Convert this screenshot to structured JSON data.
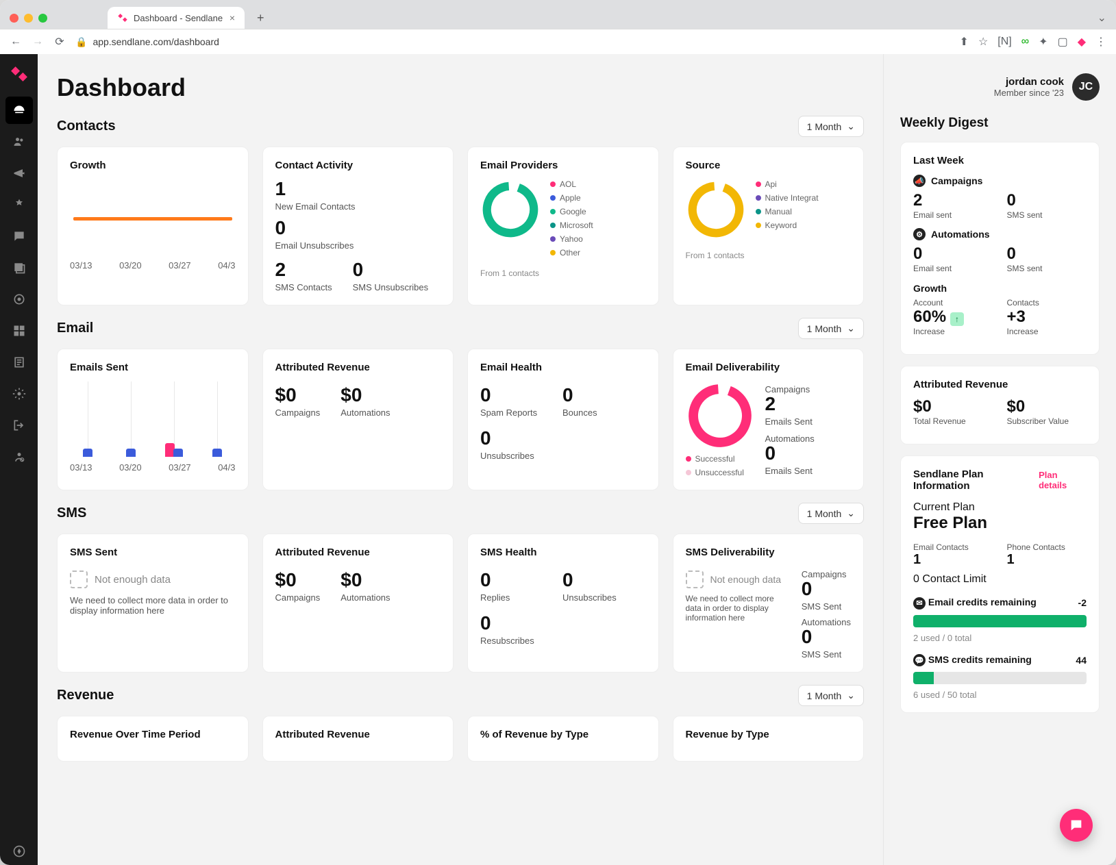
{
  "browser": {
    "tab_title": "Dashboard - Sendlane",
    "url": "app.sendlane.com/dashboard"
  },
  "page_title": "Dashboard",
  "user": {
    "name": "jordan cook",
    "member_since": "Member since '23",
    "initials": "JC"
  },
  "range_label": "1 Month",
  "contacts": {
    "title": "Contacts",
    "growth": {
      "title": "Growth",
      "x": [
        "03/13",
        "03/20",
        "03/27",
        "04/3"
      ]
    },
    "activity": {
      "title": "Contact Activity",
      "new_email_value": "1",
      "new_email_label": "New Email Contacts",
      "unsub_value": "0",
      "unsub_label": "Email Unsubscribes",
      "sms_contacts_value": "2",
      "sms_contacts_label": "SMS Contacts",
      "sms_unsub_value": "0",
      "sms_unsub_label": "SMS Unsubscribes"
    },
    "providers": {
      "title": "Email Providers",
      "legend": [
        "AOL",
        "Apple",
        "Google",
        "Microsoft",
        "Yahoo",
        "Other"
      ],
      "note": "From 1 contacts"
    },
    "source": {
      "title": "Source",
      "legend": [
        "Api",
        "Native Integrat",
        "Manual",
        "Keyword"
      ],
      "note": "From 1 contacts"
    }
  },
  "email": {
    "title": "Email",
    "sent": {
      "title": "Emails Sent",
      "x": [
        "03/13",
        "03/20",
        "03/27",
        "04/3"
      ]
    },
    "attributed": {
      "title": "Attributed Revenue",
      "campaigns_value": "$0",
      "campaigns_label": "Campaigns",
      "automations_value": "$0",
      "automations_label": "Automations"
    },
    "health": {
      "title": "Email Health",
      "spam_value": "0",
      "spam_label": "Spam Reports",
      "bounces_value": "0",
      "bounces_label": "Bounces",
      "unsub_value": "0",
      "unsub_label": "Unsubscribes"
    },
    "deliverability": {
      "title": "Email Deliverability",
      "legend": [
        "Successful",
        "Unsuccessful"
      ],
      "campaigns_label": "Campaigns",
      "campaigns_value": "2",
      "campaigns_sub": "Emails Sent",
      "automations_label": "Automations",
      "automations_value": "0",
      "automations_sub": "Emails Sent"
    }
  },
  "sms": {
    "title": "SMS",
    "sent": {
      "title": "SMS Sent",
      "ne_title": "Not enough data",
      "ne_body": "We need to collect more data in order to display information here"
    },
    "attributed": {
      "title": "Attributed Revenue",
      "campaigns_value": "$0",
      "campaigns_label": "Campaigns",
      "automations_value": "$0",
      "automations_label": "Automations"
    },
    "health": {
      "title": "SMS Health",
      "replies_value": "0",
      "replies_label": "Replies",
      "unsub_value": "0",
      "unsub_label": "Unsubscribes",
      "resub_value": "0",
      "resub_label": "Resubscribes"
    },
    "deliverability": {
      "title": "SMS Deliverability",
      "ne_title": "Not enough data",
      "ne_body": "We need to collect more data in order to display information here",
      "campaigns_label": "Campaigns",
      "campaigns_value": "0",
      "campaigns_sub": "SMS Sent",
      "automations_label": "Automations",
      "automations_value": "0",
      "automations_sub": "SMS Sent"
    }
  },
  "revenue": {
    "title": "Revenue",
    "cards": [
      "Revenue Over Time Period",
      "Attributed Revenue",
      "% of Revenue by Type",
      "Revenue by Type"
    ]
  },
  "digest": {
    "title": "Weekly Digest",
    "last_week": "Last Week",
    "campaigns_label": "Campaigns",
    "campaigns_email_value": "2",
    "campaigns_email_label": "Email sent",
    "campaigns_sms_value": "0",
    "campaigns_sms_label": "SMS sent",
    "automations_label": "Automations",
    "auto_email_value": "0",
    "auto_email_label": "Email sent",
    "auto_sms_value": "0",
    "auto_sms_label": "SMS sent",
    "growth_label": "Growth",
    "account_label": "Account",
    "account_value": "60%",
    "account_sub": "Increase",
    "contacts_label": "Contacts",
    "contacts_value": "+3",
    "contacts_sub": "Increase"
  },
  "attributed_rail": {
    "title": "Attributed Revenue",
    "total_value": "$0",
    "total_label": "Total Revenue",
    "sub_value": "$0",
    "sub_label": "Subscriber Value"
  },
  "plan": {
    "title": "Sendlane Plan Information",
    "details": "Plan details",
    "current_label": "Current Plan",
    "current_value": "Free Plan",
    "email_contacts_label": "Email Contacts",
    "email_contacts_value": "1",
    "phone_contacts_label": "Phone Contacts",
    "phone_contacts_value": "1",
    "contact_limit": "0 Contact Limit",
    "email_credits_label": "Email credits remaining",
    "email_credits_value": "-2",
    "email_credits_note": "2 used / 0 total",
    "sms_credits_label": "SMS credits remaining",
    "sms_credits_value": "44",
    "sms_credits_note": "6 used / 50 total"
  },
  "chart_data": [
    {
      "type": "line",
      "title": "Growth",
      "x": [
        "03/13",
        "03/20",
        "03/27",
        "04/3"
      ],
      "values": [
        1,
        1,
        1,
        1
      ],
      "ylim": [
        0,
        2
      ]
    },
    {
      "type": "pie",
      "title": "Email Providers",
      "categories": [
        "AOL",
        "Apple",
        "Google",
        "Microsoft",
        "Yahoo",
        "Other"
      ],
      "values": [
        0,
        0,
        1,
        0,
        0,
        0
      ],
      "note": "From 1 contacts"
    },
    {
      "type": "pie",
      "title": "Source",
      "categories": [
        "Api",
        "Native Integrat",
        "Manual",
        "Keyword"
      ],
      "values": [
        0,
        0,
        0,
        1
      ],
      "note": "From 1 contacts"
    },
    {
      "type": "bar",
      "title": "Emails Sent",
      "categories": [
        "03/13",
        "03/20",
        "03/27",
        "04/3"
      ],
      "series": [
        {
          "name": "Campaigns",
          "values": [
            1,
            1,
            1,
            1
          ]
        },
        {
          "name": "Automations",
          "values": [
            0,
            0,
            1,
            0
          ]
        }
      ]
    },
    {
      "type": "pie",
      "title": "Email Deliverability",
      "categories": [
        "Successful",
        "Unsuccessful"
      ],
      "values": [
        2,
        0
      ]
    }
  ]
}
